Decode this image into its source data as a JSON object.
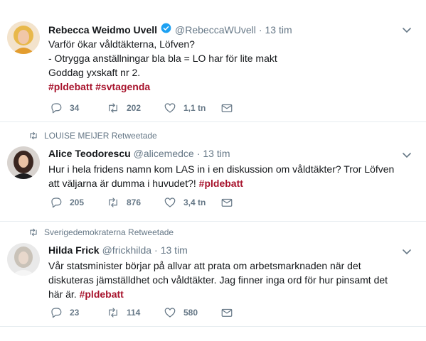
{
  "colors": {
    "hashtag": "#a7132c",
    "muted": "#657786",
    "verified": "#1da1f2",
    "divider": "#e6ecf0"
  },
  "tweets": [
    {
      "retweet_context": "",
      "name": "Rebecca Weidmo Uvell",
      "verified": true,
      "handle": "@RebeccaWUvell",
      "time": "13 tim",
      "lines": [
        "Varför ökar våldtäkterna, Löfven?",
        "- Otrygga anställningar bla bla = LO har för lite makt",
        "Goddag yxskaft nr 2."
      ],
      "hashtags": [
        "#pldebatt",
        "#svtagenda"
      ],
      "replies": "34",
      "retweets": "202",
      "likes": "1,1 tn"
    },
    {
      "retweet_context": "LOUISE MEIJER Retweetade",
      "name": "Alice Teodorescu",
      "verified": false,
      "handle": "@alicemedce",
      "time": "13 tim",
      "line1": "Hur i hela fridens namn kom LAS in i en diskussion om våldtäkter? Tror Löfven",
      "line2": "att väljarna är dumma i huvudet?!",
      "hashtag": "#pldebatt",
      "replies": "205",
      "retweets": "876",
      "likes": "3,4 tn"
    },
    {
      "retweet_context": "Sverigedemokraterna Retweetade",
      "name": "Hilda Frick",
      "verified": false,
      "handle": "@frickhilda",
      "time": "13 tim",
      "line1": "Vår statsminister börjar på allvar att prata om arbetsmarknaden när det",
      "line2": "diskuteras jämställdhet och våldtäkter. Jag finner inga ord för hur pinsamt det",
      "line3": "här är.",
      "hashtag": "#pldebatt",
      "replies": "23",
      "retweets": "114",
      "likes": "580"
    }
  ],
  "icons": {
    "reply": "reply-icon",
    "retweet": "retweet-icon",
    "like": "heart-icon",
    "message": "envelope-icon",
    "caret": "chevron-down-icon",
    "verified": "verified-badge-icon"
  }
}
